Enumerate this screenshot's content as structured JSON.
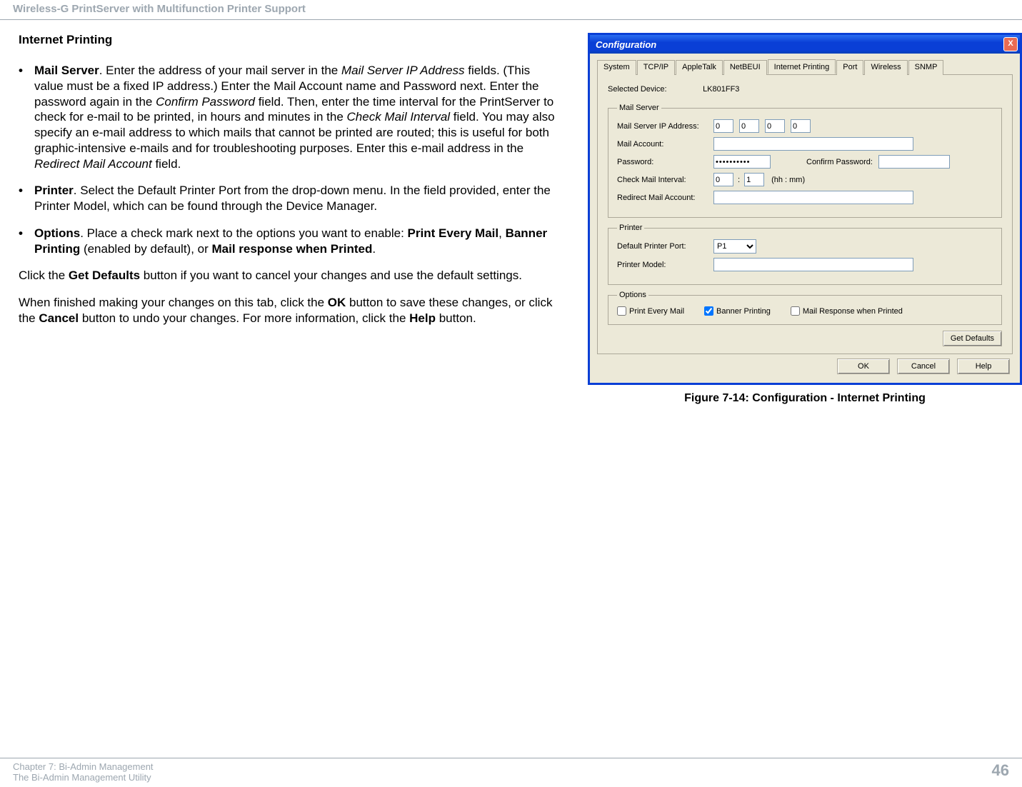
{
  "page_header": "Wireless-G PrintServer with Multifunction Printer Support",
  "section_title": "Internet Printing",
  "bullets": {
    "mail_server": {
      "lead": "Mail Server",
      "t1": ". Enter the address of your mail server in the ",
      "i1": "Mail Server IP Address",
      "t2": " fields. (This value must be a fixed IP address.) Enter the Mail Account name and Password next. Enter the password again in the ",
      "i2": "Confirm Password",
      "t3": " field. Then, enter the time interval for the PrintServer to check for e-mail to be printed, in hours and minutes in the ",
      "i3": "Check Mail Interval",
      "t4": " field. You may also specify an e-mail address to which mails that cannot be printed are routed; this is useful for both graphic-intensive e-mails and for troubleshooting purposes. Enter this e-mail address in the ",
      "i4": "Redirect Mail Account",
      "t5": " field."
    },
    "printer": {
      "lead": "Printer",
      "t1": ". Select the Default Printer Port from the drop-down menu. In the field provided, enter the Printer Model, which can be found through the Device Manager."
    },
    "options": {
      "lead": "Options",
      "t1": ". Place a check mark next to the options you want to enable: ",
      "b1": "Print Every Mail",
      "t2": ", ",
      "b2": "Banner Printing",
      "t3": " (enabled by default), or ",
      "b3": "Mail response when Printed",
      "t4": "."
    }
  },
  "para_defaults": {
    "t1": "Click the ",
    "b1": "Get Defaults",
    "t2": " button if you want to cancel your changes and use the default settings."
  },
  "para_finish": {
    "t1": "When finished making your changes on this tab, click the ",
    "b1": "OK",
    "t2": " button to save these changes, or click the ",
    "b2": "Cancel",
    "t3": " button to undo your changes. For more information, click the ",
    "b3": "Help",
    "t4": " button."
  },
  "cfg": {
    "title": "Configuration",
    "close": "X",
    "tabs": [
      "System",
      "TCP/IP",
      "AppleTalk",
      "NetBEUI",
      "Internet Printing",
      "Port",
      "Wireless",
      "SNMP"
    ],
    "active_tab_index": 4,
    "selected_device_label": "Selected Device:",
    "selected_device_value": "LK801FF3",
    "groups": {
      "mail": {
        "legend": "Mail Server",
        "ip_label": "Mail Server IP Address:",
        "ip": [
          "0",
          "0",
          "0",
          "0"
        ],
        "account_label": "Mail Account:",
        "account_value": "",
        "password_label": "Password:",
        "password_value": "••••••••••",
        "confirm_label": "Confirm Password:",
        "confirm_value": "",
        "interval_label": "Check Mail Interval:",
        "interval_hh": "0",
        "interval_sep": ":",
        "interval_mm": "1",
        "interval_unit": "(hh : mm)",
        "redirect_label": "Redirect Mail Account:",
        "redirect_value": ""
      },
      "printer": {
        "legend": "Printer",
        "port_label": "Default Printer Port:",
        "port_value": "P1",
        "model_label": "Printer Model:",
        "model_value": ""
      },
      "options": {
        "legend": "Options",
        "opt1": "Print Every Mail",
        "opt1_checked": false,
        "opt2": "Banner Printing",
        "opt2_checked": true,
        "opt3": "Mail Response when Printed",
        "opt3_checked": false
      }
    },
    "get_defaults": "Get Defaults",
    "ok": "OK",
    "cancel": "Cancel",
    "help": "Help"
  },
  "figure_caption": "Figure 7-14: Configuration - Internet Printing",
  "footer": {
    "line1": "Chapter 7: Bi-Admin Management",
    "line2": "The Bi-Admin Management Utility",
    "page": "46"
  }
}
